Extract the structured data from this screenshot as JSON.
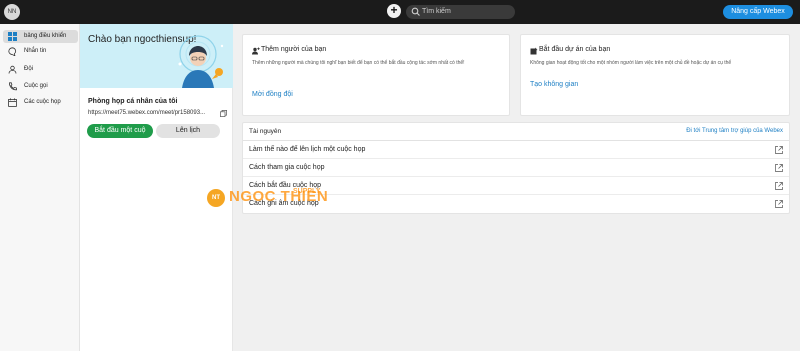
{
  "topbar": {
    "avatar_initials": "NN",
    "add_label": "+",
    "search_placeholder": "Tìm kiếm",
    "upgrade_label": "Nâng cấp Webex",
    "upgrade_color": "#1d8ee0"
  },
  "sidebar": {
    "items": [
      {
        "label": "bảng điều khiển",
        "icon": "dashboard-icon",
        "active": true
      },
      {
        "label": "Nhắn tin",
        "icon": "chat-icon",
        "active": false
      },
      {
        "label": "Đội",
        "icon": "team-icon",
        "active": false
      },
      {
        "label": "Cuộc gọi",
        "icon": "phone-icon",
        "active": false
      },
      {
        "label": "Các cuộc họp",
        "icon": "calendar-icon",
        "active": false
      }
    ]
  },
  "welcome": {
    "greeting": "Chào bạn ngocthiensup!"
  },
  "personal_room": {
    "title": "Phòng họp cá nhân của tôi",
    "link": "https://meet75.webex.com/meet/pr158093...",
    "start_button": "Bắt đầu một cuộ",
    "schedule_button": "Lên lịch",
    "start_color": "#1f9c4a"
  },
  "cards": {
    "add_people": {
      "title": "Thêm người của bạn",
      "text": "Thêm những người mà chúng tôi nghĩ bạn biết để bạn có thể bắt đầu cộng tác sớm nhất có thể!",
      "link": "Mời đồng đội"
    },
    "start_project": {
      "title": "Bắt đầu dự án của bạn",
      "text": "Không gian hoạt động tốt cho một nhóm người làm việc trên một chủ đề hoặc dự án cụ thể",
      "link": "Tạo không gian"
    }
  },
  "resources": {
    "title": "Tài nguyên",
    "help_link": "Đi tới Trung tâm trợ giúp của Webex",
    "items": [
      "Làm thế nào để lên lịch một cuộc họp",
      "Cách tham gia cuộc họp",
      "Cách bắt đầu cuộc họp",
      "Cách ghi âm cuộc họp"
    ]
  },
  "watermark": {
    "badge": "NT",
    "brand": "NGOC THIEN",
    "sub": "SUPPLY"
  }
}
